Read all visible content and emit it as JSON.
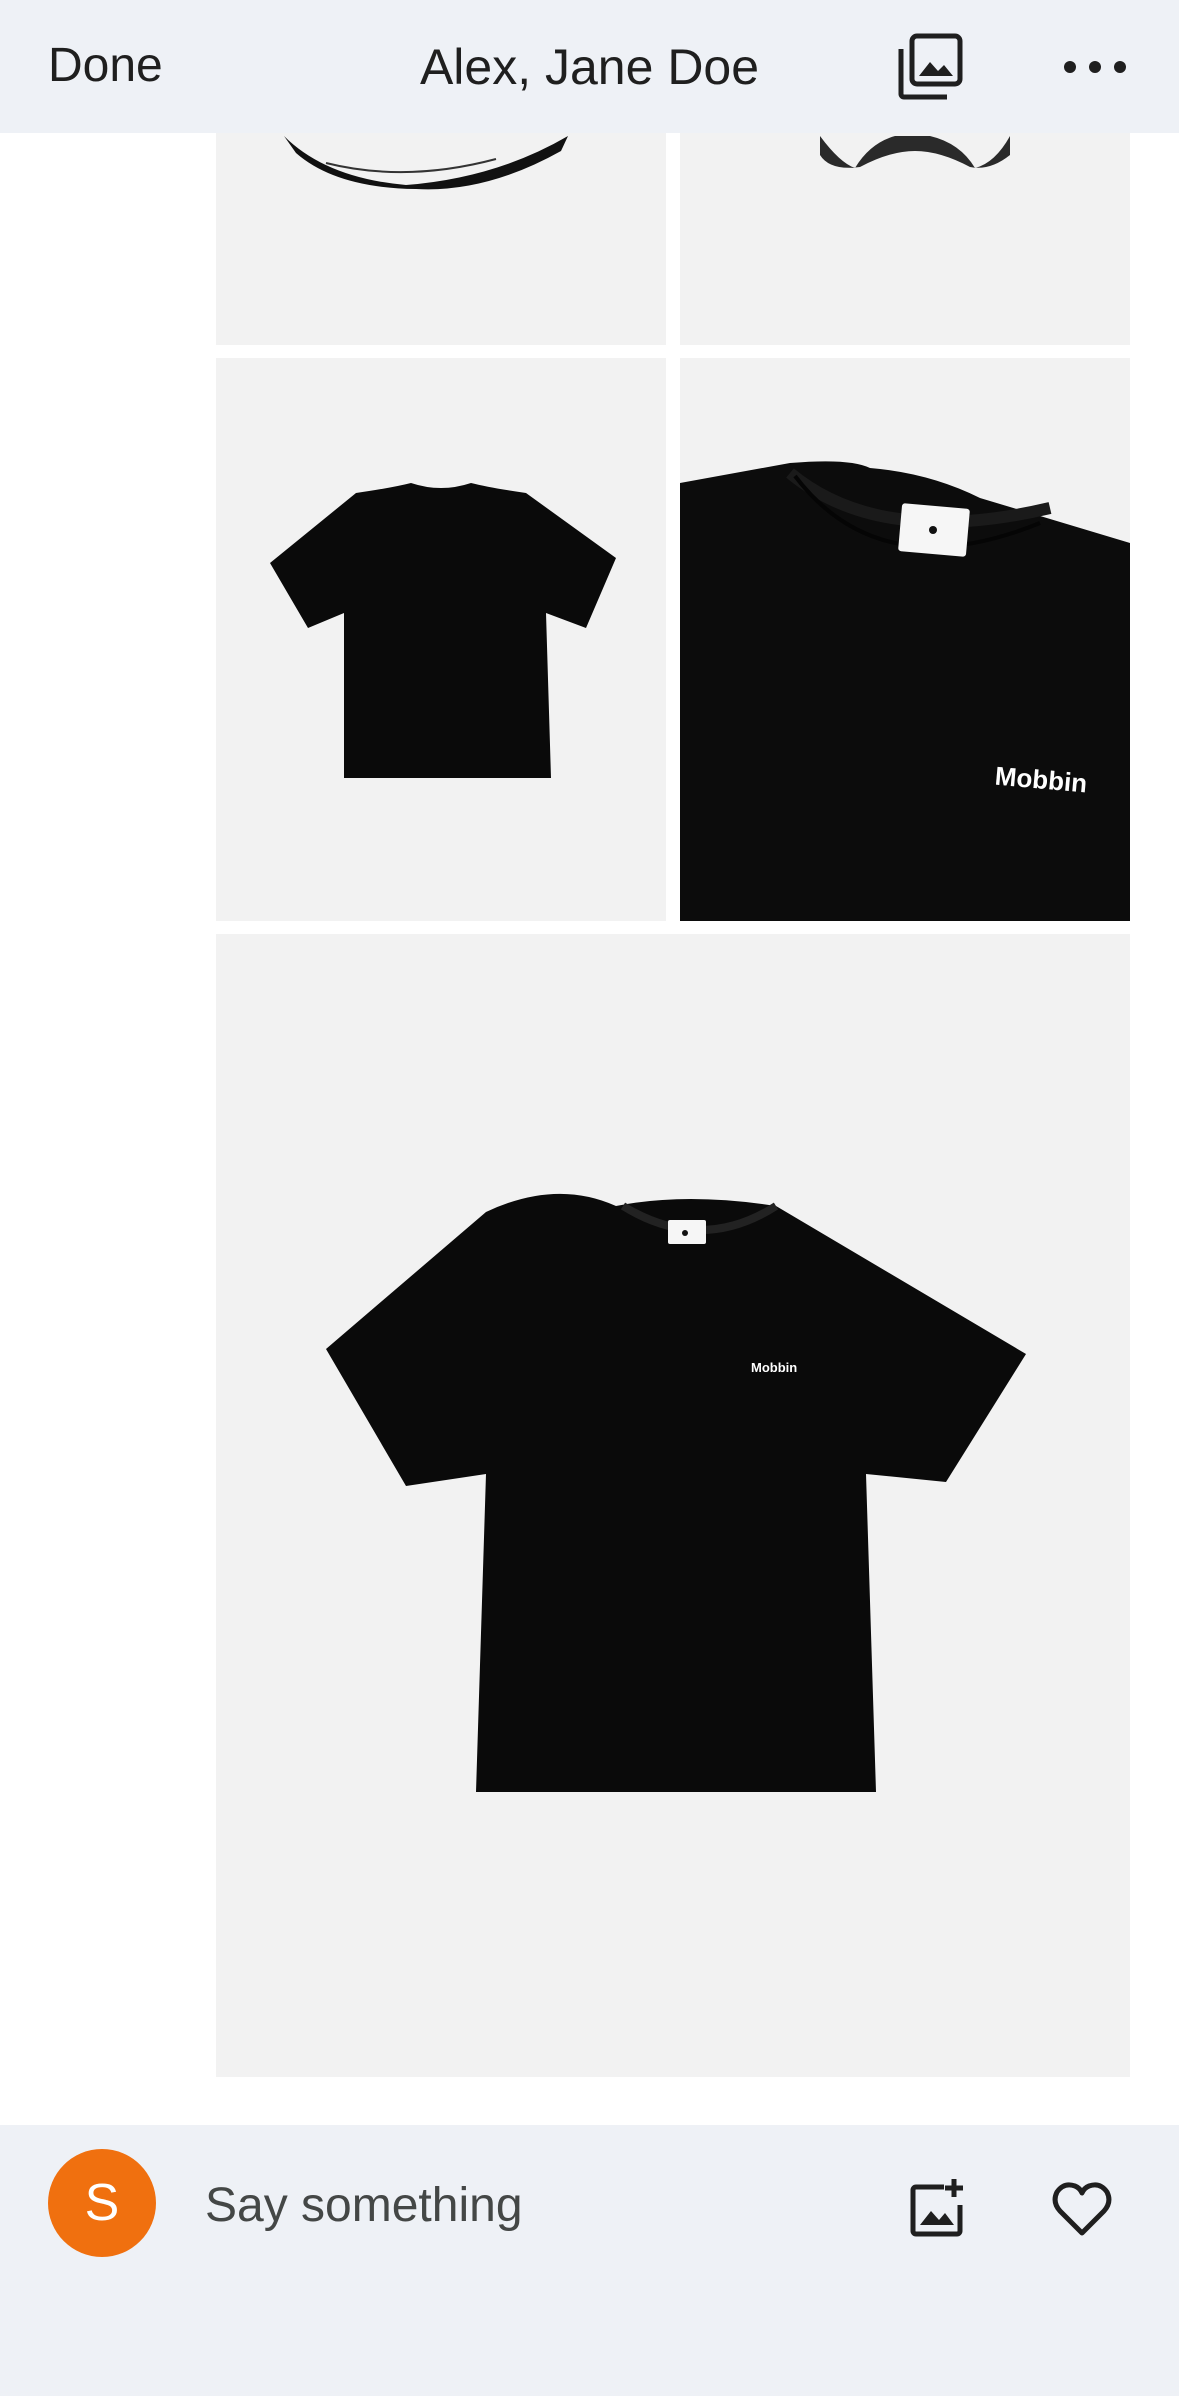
{
  "header": {
    "done_label": "Done",
    "title": "Alex, Jane Doe",
    "gallery_icon": "photo-gallery-icon",
    "more_icon": "more-horizontal-icon"
  },
  "photos": [
    {
      "subject": "black cap (cropped)",
      "bg": "#f2f2f2"
    },
    {
      "subject": "black cap (cropped)",
      "bg": "#f2f2f2"
    },
    {
      "subject": "black t-shirt flat lay",
      "bg": "#f2f2f2"
    },
    {
      "subject": "black t-shirt collar close-up",
      "bg": "#0c0c0c",
      "print_text": "Mobbin"
    },
    {
      "subject": "black t-shirt front",
      "bg": "#f2f2f2",
      "print_text": "Mobbin"
    }
  ],
  "composer": {
    "avatar_initial": "S",
    "avatar_color": "#f0700f",
    "placeholder": "Say something",
    "add_photo_icon": "add-photo-icon",
    "like_icon": "heart-icon"
  },
  "colors": {
    "bar_background": "#eef1f6",
    "photo_background": "#f2f2f2"
  }
}
